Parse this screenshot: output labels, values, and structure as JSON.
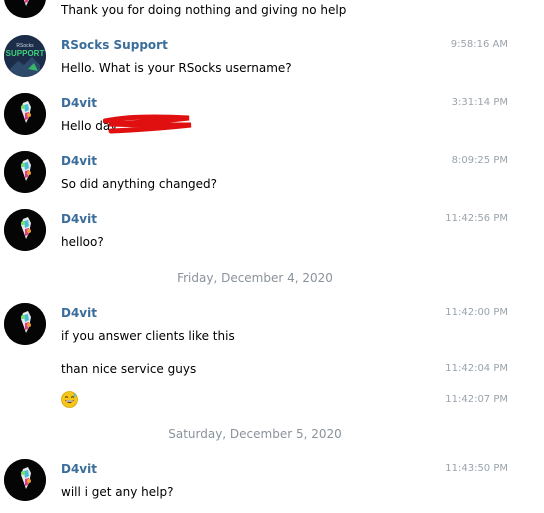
{
  "messages": [
    {
      "text": "Thank you for doing nothing and giving no help"
    },
    {
      "sender": "RSocks Support",
      "time": "9:58:16 AM",
      "text": "Hello. What is your RSocks username?"
    },
    {
      "sender": "D4vit",
      "time": "3:31:14 PM",
      "text": "Hello dav"
    },
    {
      "sender": "D4vit",
      "time": "8:09:25 PM",
      "text": "So did anything changed?"
    },
    {
      "sender": "D4vit",
      "time": "11:42:56 PM",
      "text": "helloo?"
    },
    {
      "date": "Friday, December 4, 2020"
    },
    {
      "sender": "D4vit",
      "time": "11:42:00 PM",
      "text": "if you answer clients like this"
    },
    {
      "time": "11:42:04 PM",
      "text": "than nice service guys"
    },
    {
      "time": "11:42:07 PM",
      "emoji": "grinning-sweat-emoji"
    },
    {
      "date": "Saturday, December 5, 2020"
    },
    {
      "sender": "D4vit",
      "time": "11:43:50 PM",
      "text": "will i get any help?"
    }
  ],
  "support_avatar": {
    "line1": "RSocks",
    "line2": "SUPPORT"
  },
  "colors": {
    "sender": "#3a6d99",
    "time": "#9aa3ab",
    "redaction": "#e01010",
    "emoji": "#f5c518"
  }
}
